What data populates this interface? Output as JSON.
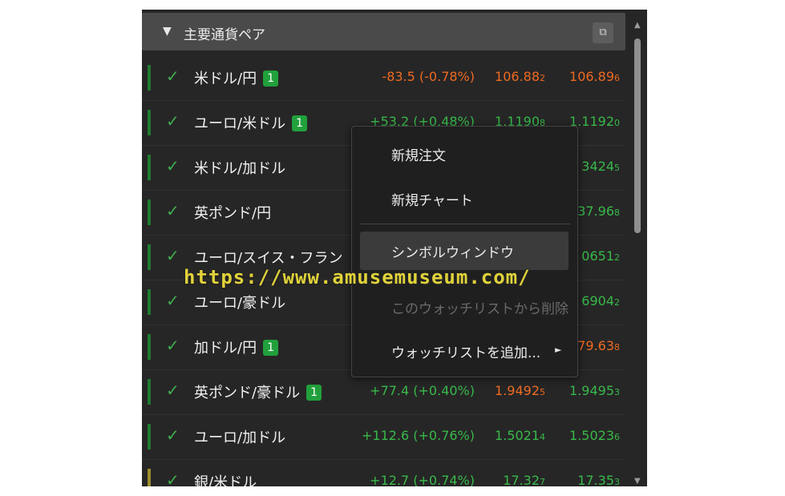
{
  "panel": {
    "title": "主要通貨ペア",
    "collapse_icon": "▼",
    "popout_icon": "⧉"
  },
  "rows": [
    {
      "name": "米ドル/円",
      "badge": "1",
      "change": "-83.5 (-0.78%)",
      "bid_main": "106.88",
      "bid_sub": "2",
      "ask_main": "106.89",
      "ask_sub": "6"
    },
    {
      "name": "ユーロ/米ドル",
      "badge": "1",
      "change": "+53.2 (+0.48%)",
      "bid_main": "1.1190",
      "bid_sub": "8",
      "ask_main": "1.1192",
      "ask_sub": "0"
    },
    {
      "name": "米ドル/加ドル",
      "ask_main": "3424",
      "ask_sub": "5"
    },
    {
      "name": "英ポンド/円",
      "ask_main": "37.96",
      "ask_sub": "8"
    },
    {
      "name": "ユーロ/スイス・フラン",
      "ask_main": "0651",
      "ask_sub": "2"
    },
    {
      "name": "ユーロ/豪ドル",
      "ask_main": "6904",
      "ask_sub": "2"
    },
    {
      "name": "加ドル/円",
      "badge": "1",
      "ask_main": "79.63",
      "ask_sub": "8"
    },
    {
      "name": "英ポンド/豪ドル",
      "badge": "1",
      "change": "+77.4 (+0.40%)",
      "bid_main": "1.9492",
      "bid_sub": "5",
      "ask_main": "1.9495",
      "ask_sub": "3"
    },
    {
      "name": "ユーロ/加ドル",
      "change": "+112.6 (+0.76%)",
      "bid_main": "1.5021",
      "bid_sub": "4",
      "ask_main": "1.5023",
      "ask_sub": "6"
    },
    {
      "name": "銀/米ドル",
      "change": "+12.7 (+0.74%)",
      "bid_main": "17.32",
      "bid_sub": "7",
      "ask_main": "17.35",
      "ask_sub": "3"
    }
  ],
  "context_menu": {
    "new_order": "新規注文",
    "new_chart": "新規チャート",
    "symbol_window": "シンボルウィンドウ",
    "remove_from_watchlist": "このウォッチリストから削除",
    "add_watchlist": "ウォッチリストを追加...",
    "submenu_arrow": "►"
  },
  "watermark": "https://www.amusemuseum.com/",
  "colors": {
    "negative": "#ee6a22",
    "positive": "#38b94a",
    "badge": "#21a03c",
    "background": "#262626"
  }
}
